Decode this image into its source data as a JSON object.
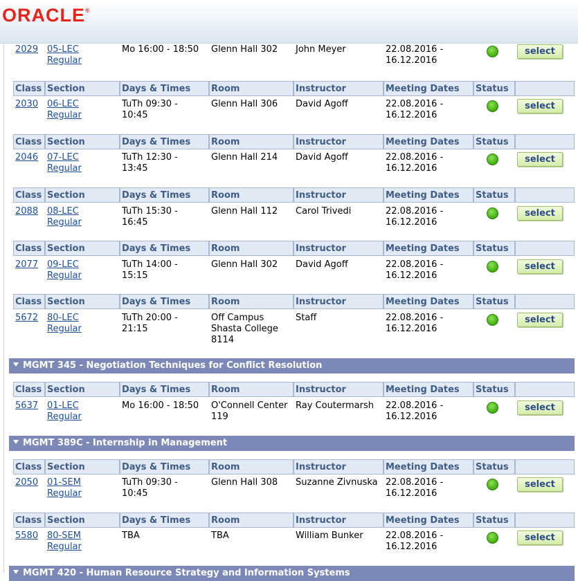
{
  "brand": {
    "logo_text": "ORACLE",
    "logo_mark": "®"
  },
  "columns": {
    "class": "Class",
    "section": "Section",
    "days_times": "Days & Times",
    "room": "Room",
    "instructor": "Instructor",
    "meeting_dates": "Meeting Dates",
    "status": "Status"
  },
  "select_label": "select",
  "status_icon": "open-status-icon",
  "colors": {
    "group_header_bg": "#7c88b8",
    "column_header_bg": "#e1e9f4",
    "link": "#1f4e9c",
    "status_open": "#4cbb17",
    "logo": "#e8231b"
  },
  "sections": [
    {
      "class": "2029",
      "section": "05-LEC",
      "component": "Regular",
      "days_times": [
        "Mo 16:00 - 18:50"
      ],
      "room": [
        "Glenn Hall 302"
      ],
      "instructor": "John Meyer",
      "meeting_dates": [
        "22.08.2016 -",
        "16.12.2016"
      ]
    },
    {
      "class": "2030",
      "section": "06-LEC",
      "component": "Regular",
      "days_times": [
        "TuTh 09:30 -",
        "10:45"
      ],
      "room": [
        "Glenn Hall 306"
      ],
      "instructor": "David Agoff",
      "meeting_dates": [
        "22.08.2016 -",
        "16.12.2016"
      ]
    },
    {
      "class": "2046",
      "section": "07-LEC",
      "component": "Regular",
      "days_times": [
        "TuTh 12:30 -",
        "13:45"
      ],
      "room": [
        "Glenn Hall 214"
      ],
      "instructor": "David Agoff",
      "meeting_dates": [
        "22.08.2016 -",
        "16.12.2016"
      ]
    },
    {
      "class": "2088",
      "section": "08-LEC",
      "component": "Regular",
      "days_times": [
        "TuTh 15:30 -",
        "16:45"
      ],
      "room": [
        "Glenn Hall 112"
      ],
      "instructor": "Carol Trivedi",
      "meeting_dates": [
        "22.08.2016 -",
        "16.12.2016"
      ]
    },
    {
      "class": "2077",
      "section": "09-LEC",
      "component": "Regular",
      "days_times": [
        "TuTh 14:00 -",
        "15:15"
      ],
      "room": [
        "Glenn Hall 302"
      ],
      "instructor": "David Agoff",
      "meeting_dates": [
        "22.08.2016 -",
        "16.12.2016"
      ]
    },
    {
      "class": "5672",
      "section": "80-LEC",
      "component": "Regular",
      "days_times": [
        "TuTh 20:00 -",
        "21:15"
      ],
      "room": [
        "Off Campus",
        "Shasta College",
        "8114"
      ],
      "instructor": "Staff",
      "meeting_dates": [
        "22.08.2016 -",
        "16.12.2016"
      ]
    },
    {
      "class": "5637",
      "section": "01-LEC",
      "component": "Regular",
      "days_times": [
        "Mo 16:00 - 18:50"
      ],
      "room": [
        "O'Connell Center",
        "119"
      ],
      "instructor": "Ray Coutermarsh",
      "meeting_dates": [
        "22.08.2016 -",
        "16.12.2016"
      ]
    },
    {
      "class": "2050",
      "section": "01-SEM",
      "component": "Regular",
      "days_times": [
        "TuTh 09:30 -",
        "10:45"
      ],
      "room": [
        "Glenn Hall 308"
      ],
      "instructor": "Suzanne Zivnuska",
      "meeting_dates": [
        "22.08.2016 -",
        "16.12.2016"
      ]
    },
    {
      "class": "5580",
      "section": "80-SEM",
      "component": "Regular",
      "days_times": [
        "TBA"
      ],
      "room": [
        "TBA"
      ],
      "instructor": "William Bunker",
      "meeting_dates": [
        "22.08.2016 -",
        "16.12.2016"
      ]
    }
  ],
  "course_groups": [
    {
      "title": "MGMT 345 - Negotiation Techniques for Conflict Resolution"
    },
    {
      "title": "MGMT 389C - Internship in Management"
    },
    {
      "title": "MGMT 420 - Human Resource Strategy and Information Systems"
    }
  ]
}
